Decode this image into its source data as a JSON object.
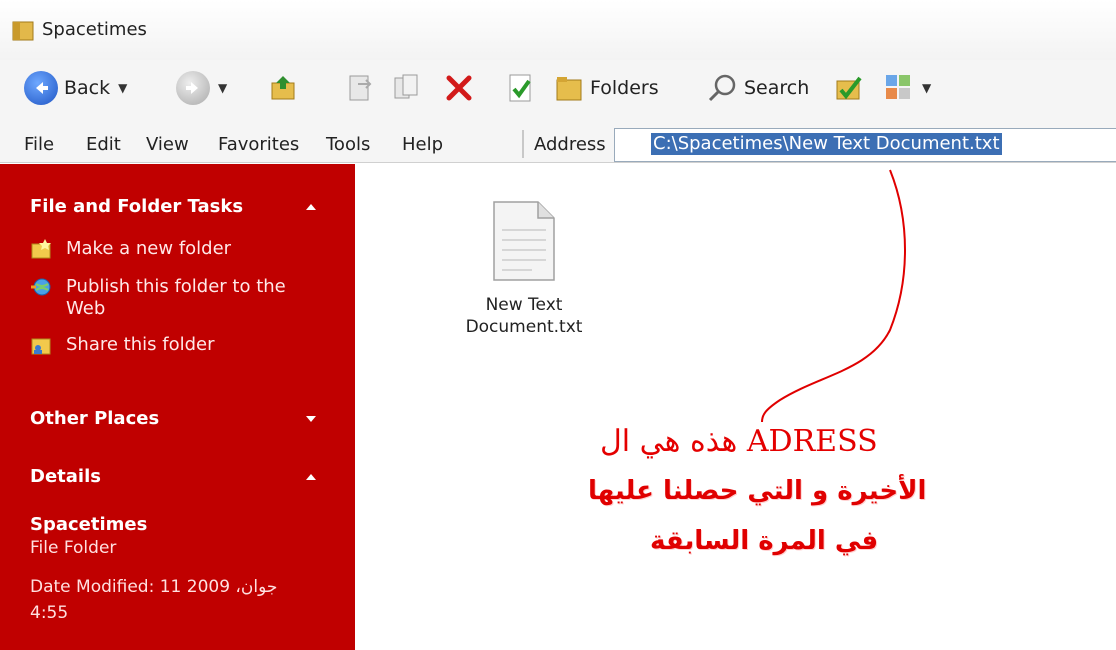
{
  "window": {
    "title": "Spacetimes"
  },
  "toolbar": {
    "back_label": "Back",
    "folders_label": "Folders",
    "search_label": "Search"
  },
  "menu": {
    "items": [
      "File",
      "Edit",
      "View",
      "Favorites",
      "Tools",
      "Help"
    ]
  },
  "address": {
    "label": "Address",
    "value": "C:\\Spacetimes\\New Text Document.txt"
  },
  "tasks_panel": {
    "title": "File and Folder Tasks",
    "items": [
      {
        "label": "Make a new folder",
        "icon": "new-folder-icon"
      },
      {
        "label": "Publish this folder to the Web",
        "icon": "publish-web-icon"
      },
      {
        "label": "Share this folder",
        "icon": "share-folder-icon"
      }
    ]
  },
  "other_places": {
    "title": "Other Places"
  },
  "details": {
    "title": "Details",
    "name": "Spacetimes",
    "type": "File Folder",
    "date_modified": "Date Modified: 11 جوان، 2009 4:55"
  },
  "files": [
    {
      "name": "New Text Document.txt",
      "icon": "text-file-icon"
    }
  ],
  "annotation": {
    "title": "هذه هي ال ADRESS",
    "lines": [
      "الأخيرة و التي حصلنا عليها",
      "في المرة السابقة"
    ]
  },
  "colors": {
    "panel_bg": "#c00000",
    "selection": "#3c6fb4",
    "annotation_red": "#e00000"
  }
}
